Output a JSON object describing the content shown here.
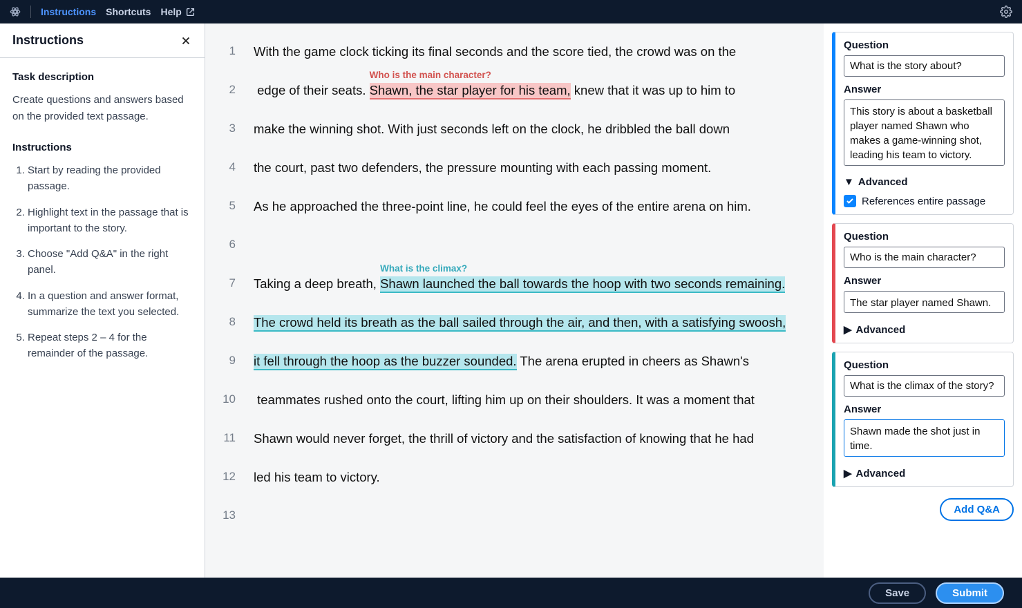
{
  "header": {
    "nav": {
      "instructions": "Instructions",
      "shortcuts": "Shortcuts",
      "help": "Help"
    }
  },
  "instructions": {
    "title": "Instructions",
    "task_heading": "Task description",
    "task_text": "Create questions and answers based on the provided text passage.",
    "steps_heading": "Instructions",
    "steps": [
      "Start by reading the provided passage.",
      "Highlight text in the passage that is important to the story.",
      "Choose \"Add Q&A\" in the right panel.",
      "In a question and answer format, summarize the text you selected.",
      "Repeat steps 2 – 4 for the remainder of the passage."
    ]
  },
  "passage": {
    "lines": [
      {
        "n": "1",
        "prefix": "With the game clock ticking its final seconds and the score tied, the crowd was on the",
        "hl": "",
        "label": "",
        "suffix": "",
        "hl_class": ""
      },
      {
        "n": "2",
        "prefix": " edge of their seats. ",
        "hl": "Shawn, the star player for his team,",
        "label": "Who is the main character?",
        "suffix": " knew that it was up to him to",
        "hl_class": "pink"
      },
      {
        "n": "3",
        "prefix": "make the winning shot. With just seconds left on the clock, he dribbled the ball down",
        "hl": "",
        "label": "",
        "suffix": "",
        "hl_class": ""
      },
      {
        "n": "4",
        "prefix": "the court, past two defenders, the pressure mounting with each passing moment.",
        "hl": "",
        "label": "",
        "suffix": "",
        "hl_class": ""
      },
      {
        "n": "5",
        "prefix": "As he approached the three-point line, he could feel the eyes of the entire arena on him.",
        "hl": "",
        "label": "",
        "suffix": "",
        "hl_class": ""
      },
      {
        "n": "6",
        "prefix": "",
        "hl": "",
        "label": "",
        "suffix": "",
        "hl_class": ""
      },
      {
        "n": "7",
        "prefix": "Taking a deep breath, ",
        "hl": "Shawn launched the ball towards the hoop with two seconds remaining.",
        "label": "What is the climax?",
        "suffix": "",
        "hl_class": "teal"
      },
      {
        "n": "8",
        "prefix": "",
        "hl": "The crowd held its breath as the ball sailed through the air, and then, with a satisfying swoosh,",
        "label": "",
        "suffix": "",
        "hl_class": "teal"
      },
      {
        "n": "9",
        "prefix": "",
        "hl": "it fell through the hoop as the buzzer sounded.",
        "label": "",
        "suffix": " The arena erupted in cheers as Shawn's",
        "hl_class": "teal"
      },
      {
        "n": "10",
        "prefix": " teammates rushed onto the court, lifting him up on their shoulders. It was a moment that",
        "hl": "",
        "label": "",
        "suffix": "",
        "hl_class": ""
      },
      {
        "n": "11",
        "prefix": "Shawn would never forget, the thrill of victory and the satisfaction of knowing that he had",
        "hl": "",
        "label": "",
        "suffix": "",
        "hl_class": ""
      },
      {
        "n": "12",
        "prefix": "led his team to victory.",
        "hl": "",
        "label": "",
        "suffix": "",
        "hl_class": ""
      },
      {
        "n": "13",
        "prefix": "",
        "hl": "",
        "label": "",
        "suffix": "",
        "hl_class": ""
      }
    ]
  },
  "labels": {
    "question": "Question",
    "answer": "Answer",
    "advanced": "Advanced",
    "ref_passage": "References entire passage",
    "add_qa": "Add Q&A",
    "save": "Save",
    "submit": "Submit"
  },
  "cards": [
    {
      "color": "blue",
      "question": "What is the story about?",
      "answer": "This story is about a basketball player named Shawn who makes a game-winning shot, leading his team to victory.",
      "advanced_open": true,
      "ref_checked": true,
      "answer_class": "tall",
      "focused": false
    },
    {
      "color": "red",
      "question": "Who is the main character?",
      "answer": "The star player named Shawn.",
      "advanced_open": false,
      "ref_checked": false,
      "answer_class": "short",
      "focused": false
    },
    {
      "color": "teal",
      "question": "What is the climax of the story?",
      "answer": "Shawn made the shot just in time.",
      "advanced_open": false,
      "ref_checked": false,
      "answer_class": "med",
      "focused": true
    }
  ]
}
